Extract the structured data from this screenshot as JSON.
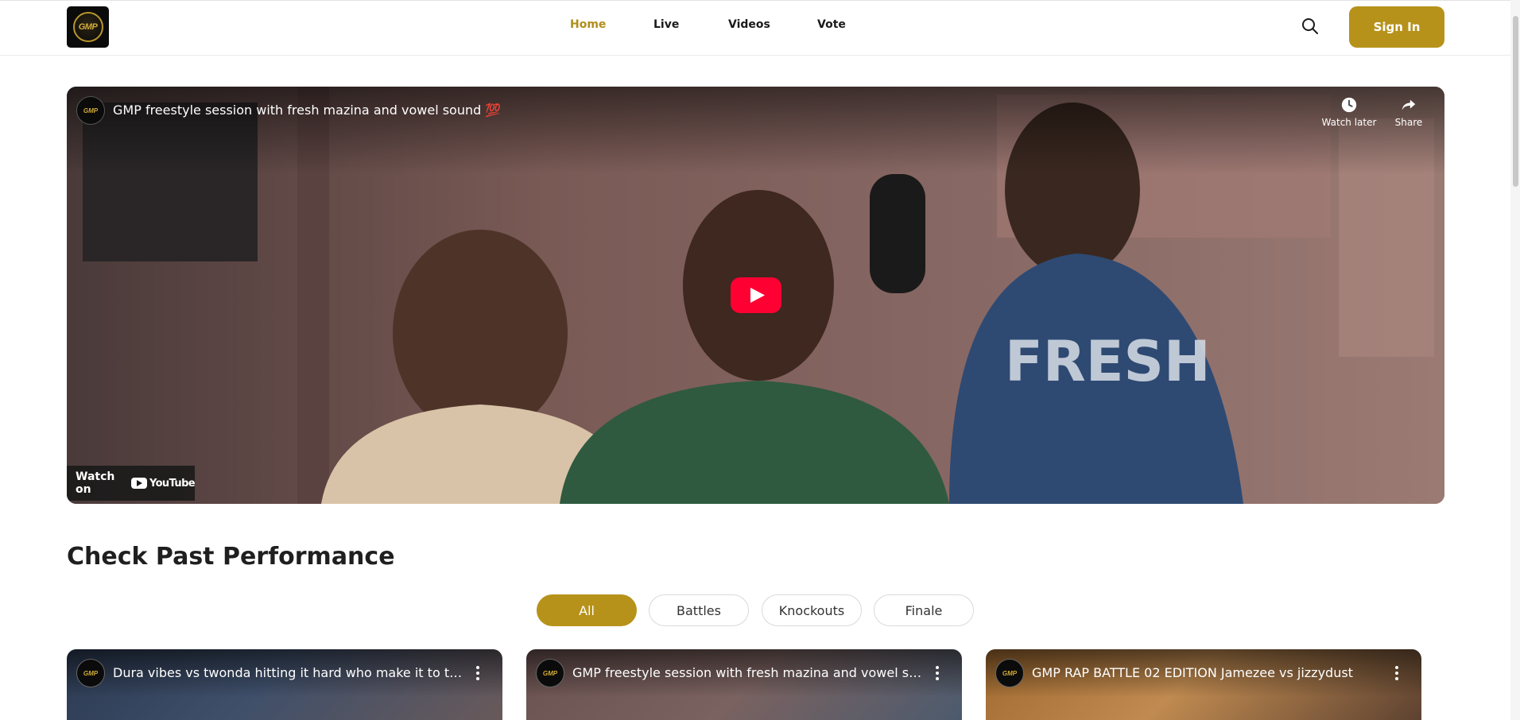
{
  "brand": {
    "logo_text": "GMP"
  },
  "nav": {
    "items": [
      {
        "label": "Home",
        "active": true
      },
      {
        "label": "Live",
        "active": false
      },
      {
        "label": "Videos",
        "active": false
      },
      {
        "label": "Vote",
        "active": false
      }
    ]
  },
  "header": {
    "signin_label": "Sign In",
    "search_icon": "search-icon"
  },
  "hero_video": {
    "title": "GMP freestyle session with fresh mazina and vowel sound 💯",
    "channel_logo_text": "GMP",
    "watch_later_label": "Watch later",
    "share_label": "Share",
    "watch_on_label": "Watch on",
    "youtube_label": "YouTube"
  },
  "section": {
    "title": "Check Past Performance",
    "filters": [
      {
        "label": "All",
        "active": true
      },
      {
        "label": "Battles",
        "active": false
      },
      {
        "label": "Knockouts",
        "active": false
      },
      {
        "label": "Finale",
        "active": false
      }
    ]
  },
  "videos": [
    {
      "title": "Dura vibes vs twonda hitting it hard who make it to the final",
      "channel_logo_text": "GMP"
    },
    {
      "title": "GMP freestyle session with fresh mazina and vowel sound 💯",
      "channel_logo_text": "GMP"
    },
    {
      "title": "GMP RAP BATTLE 02 EDITION Jamezee vs jizzydust",
      "channel_logo_text": "GMP"
    }
  ],
  "colors": {
    "accent": "#b6921a",
    "active_nav": "#b08d1a",
    "youtube_red": "#ff0033"
  }
}
